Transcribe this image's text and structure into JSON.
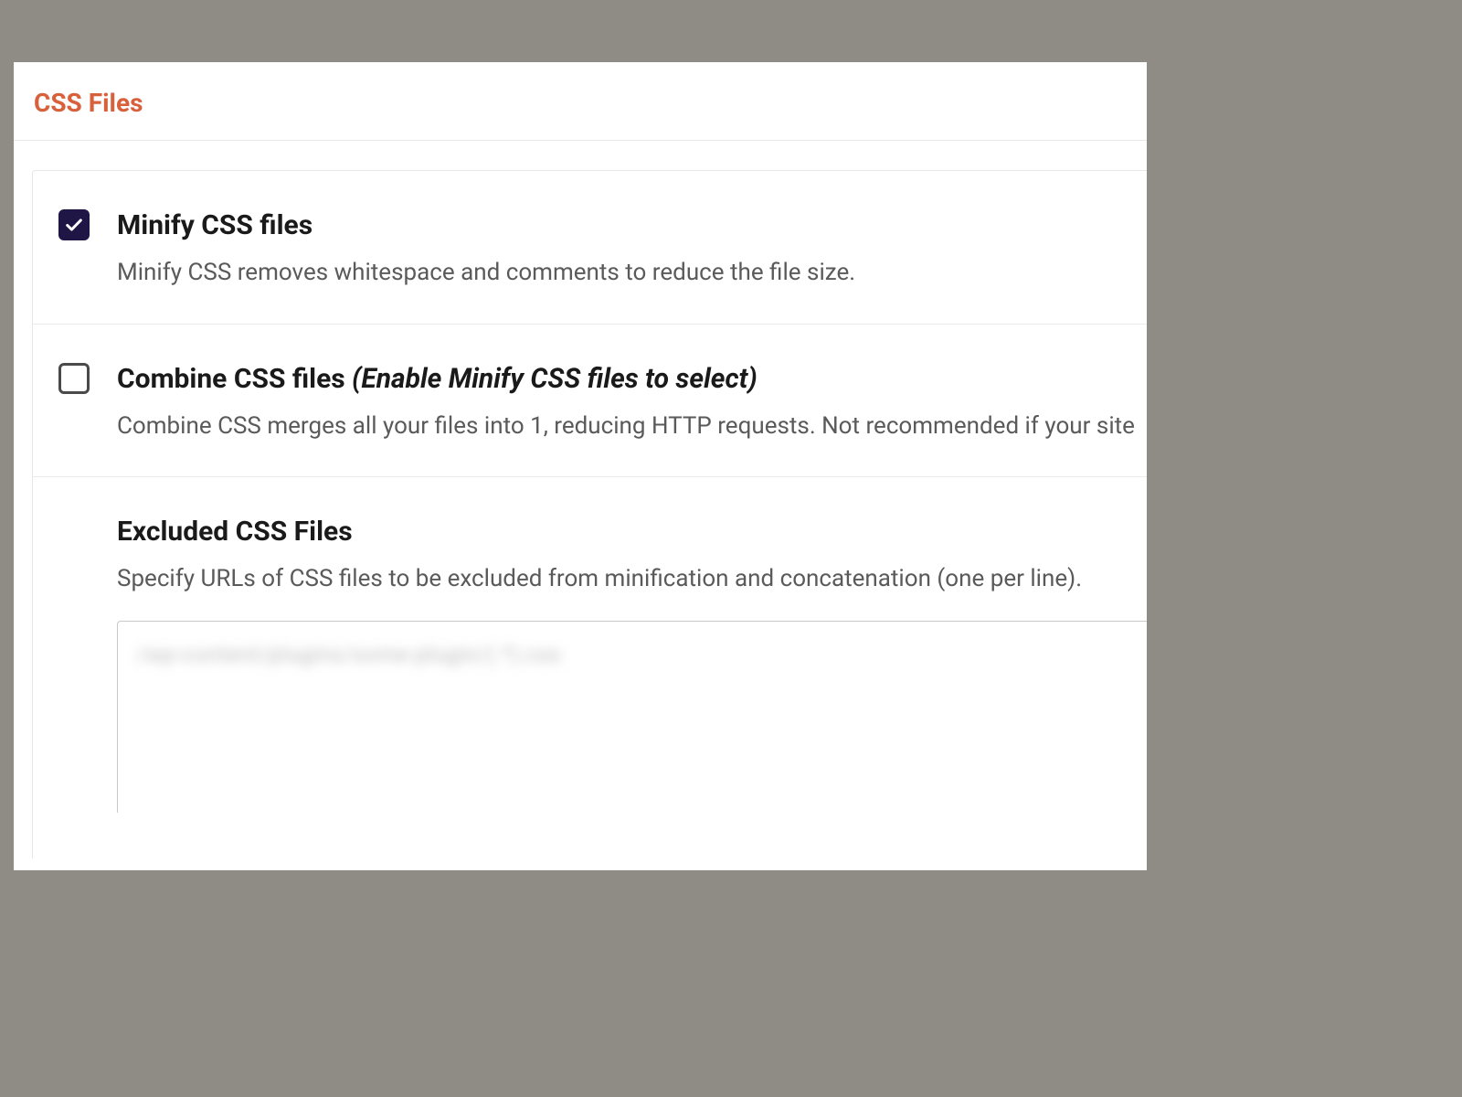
{
  "section": {
    "title": "CSS Files"
  },
  "minify": {
    "label": "Minify CSS files",
    "description": "Minify CSS removes whitespace and comments to reduce the file size.",
    "checked": true
  },
  "combine": {
    "label": "Combine CSS files ",
    "hint": "(Enable Minify CSS files to select)",
    "description": "Combine CSS merges all your files into 1, reducing HTTP requests. Not recommended if your site",
    "checked": false
  },
  "excluded": {
    "title": "Excluded CSS Files",
    "description": "Specify URLs of CSS files to be excluded from minification and concatenation (one per line).",
    "placeholder_obscured": "/wp-content/plugins/some-plugin/(.*).css"
  }
}
